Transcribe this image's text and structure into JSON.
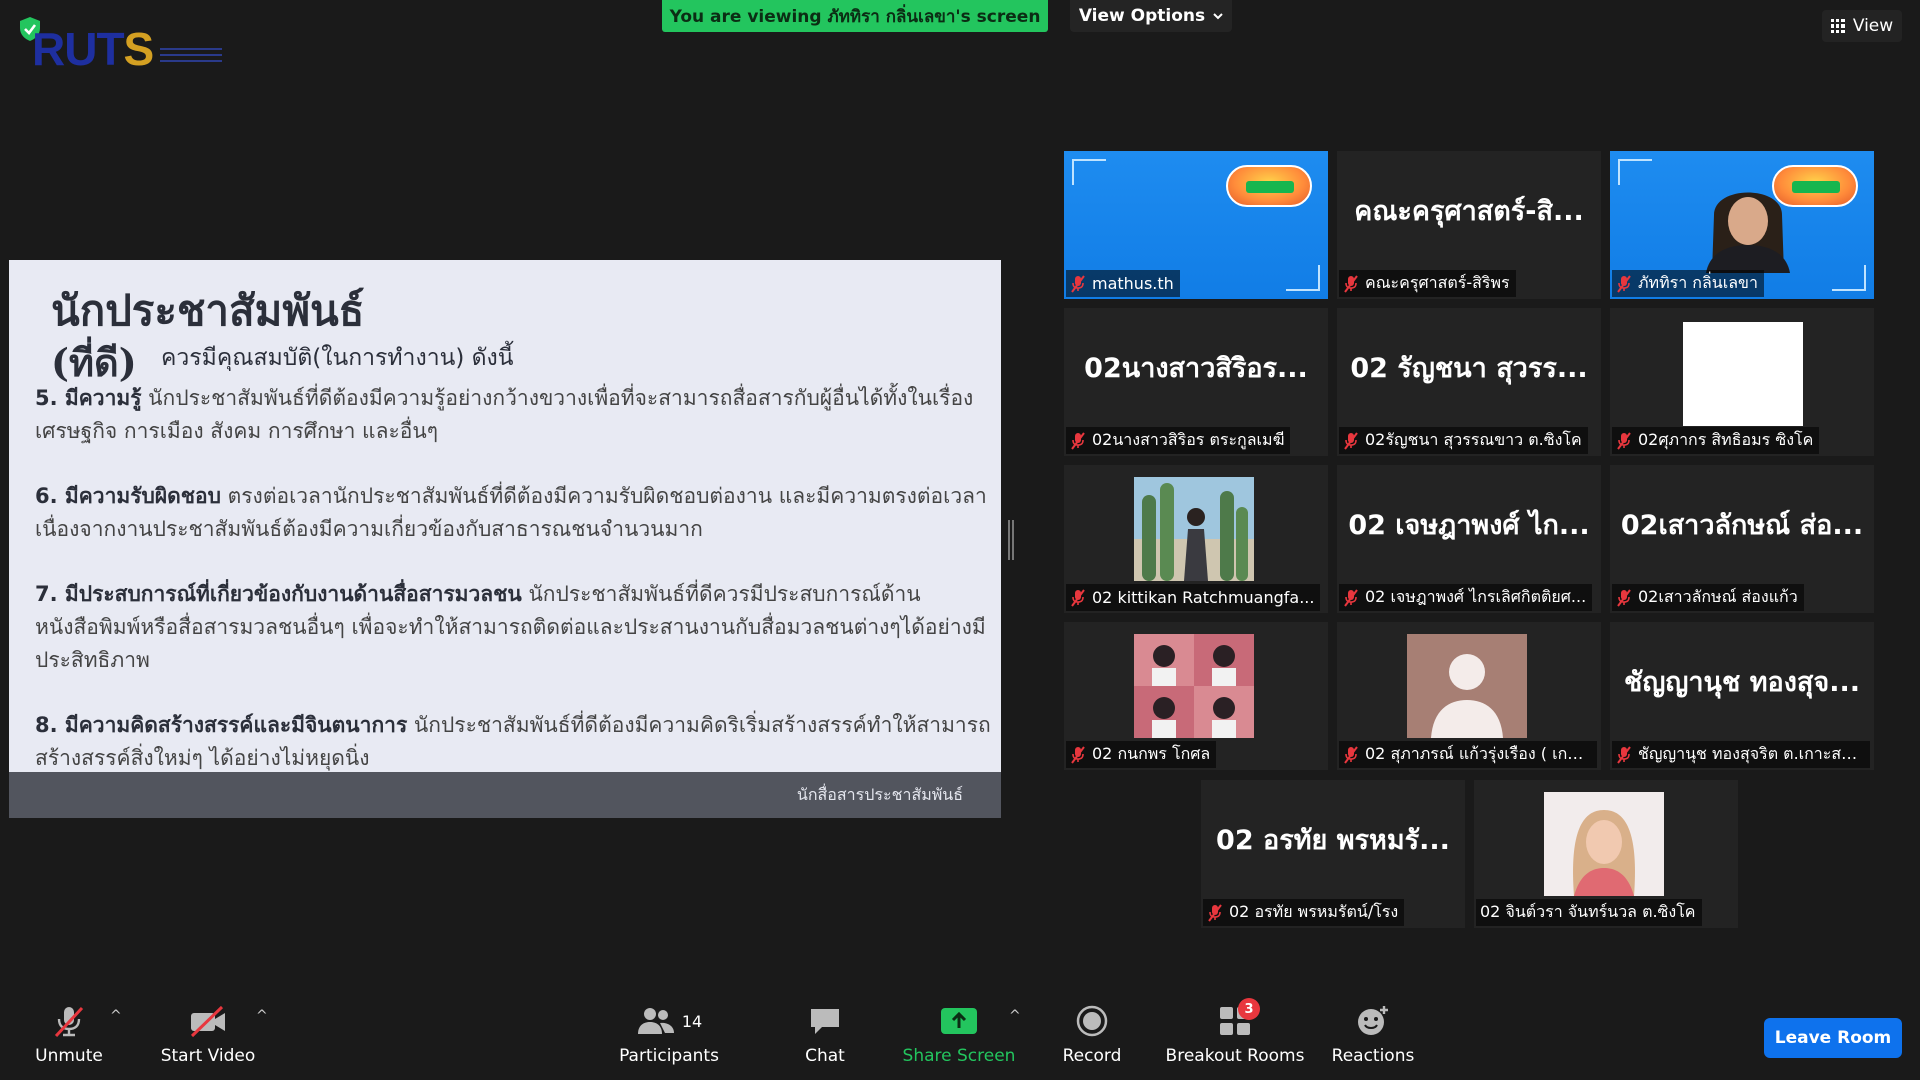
{
  "top": {
    "banner": "You are viewing ภัททิรา กลิ่นเลขา's screen",
    "view_options": "View Options",
    "view": "View",
    "logo_part1": "RUT",
    "logo_part2": "S"
  },
  "slide": {
    "title": "นักประชาสัมพันธ์",
    "subtitle_bold": "(ที่ดี)",
    "subtitle_rest": "ควรมีคุณสมบัติ(ในการทำงาน) ดังนี้",
    "items": [
      {
        "heading": "5. มีความรู้",
        "text": " นักประชาสัมพันธ์ที่ดีต้องมีความรู้อย่างกว้างขวางเพื่อที่จะสามารถสื่อสารกับผู้อื่นได้ทั้งในเรื่องเศรษฐกิจ การเมือง สังคม การศึกษา และอื่นๆ"
      },
      {
        "heading": "6. มีความรับผิดชอบ",
        "text": "  ตรงต่อเวลานักประชาสัมพันธ์ที่ดีต้องมีความรับผิดชอบต่องาน และมีความตรงต่อเวลา เนื่องจากงานประชาสัมพันธ์ต้องมีความเกี่ยวข้องกับสาธารณชนจำนวนมาก"
      },
      {
        "heading": "7. มีประสบการณ์ที่เกี่ยวข้องกับงานด้านสื่อสารมวลชน",
        "text": "  นักประชาสัมพันธ์ที่ดีควรมีประสบการณ์ด้านหนังสือพิมพ์หรือสื่อสารมวลชนอื่นๆ เพื่อจะทำให้สามารถติดต่อและประสานงานกับสื่อมวลชนต่างๆได้อย่างมีประสิทธิภาพ"
      },
      {
        "heading": "8. มีความคิดสร้างสรรค์และมีจินตนาการ",
        "text": " นักประชาสัมพันธ์ที่ดีต้องมีความคิดริเริ่มสร้างสรรค์ทำให้สามารถสร้างสรรค์สิ่งใหม่ๆ ได้อย่างไม่หยุดนิ่ง"
      }
    ],
    "footer": "นักสื่อสารประชาสัมพันธ์"
  },
  "participants": [
    {
      "label": "mathus.th",
      "display": "",
      "kind": "blue"
    },
    {
      "label": "คณะครุศาสตร์-สิริพร",
      "display": "คณะครุศาสตร์-สิ...",
      "kind": "name"
    },
    {
      "label": "ภัททิรา กลิ่นเลขา",
      "display": "",
      "kind": "blue-person"
    },
    {
      "label": "02นางสาวสิริอร ตระกูลเมฆี",
      "display": "02นางสาวสิริอร...",
      "kind": "name"
    },
    {
      "label": "02รัญชนา สุวรรณขาว ต.ซิงโค",
      "display": "02 รัญชนา สุวรร...",
      "kind": "name"
    },
    {
      "label": "02ศุภากร สิทธิอมร ซิงโค",
      "display": "",
      "kind": "white"
    },
    {
      "label": "02 kittikan Ratchmuangfa...",
      "display": "",
      "kind": "photo-cactus"
    },
    {
      "label": "02 เจษฎาพงศ์ ไกรเลิศกิตติยศ...",
      "display": "02 เจษฎาพงศ์ ไก...",
      "kind": "name"
    },
    {
      "label": "02เสาวลักษณ์ ส่องแก้ว",
      "display": "02เสาวลักษณ์ ส่อ...",
      "kind": "name"
    },
    {
      "label": "02 กนกพร โกศล",
      "display": "",
      "kind": "photo-collage"
    },
    {
      "label": "02 สุภาภรณ์ แก้วรุ่งเรือง ( เกา...",
      "display": "",
      "kind": "avatar"
    },
    {
      "label": "ชัญญานุช ทองสุจริต ต.เกาะสะ...",
      "display": "ชัญญานุช ทองสุจ...",
      "kind": "name"
    },
    {
      "label": "02 อรทัย พรหมรัตน์/โรง",
      "display": "02 อรทัย พรหมรั...",
      "kind": "name"
    },
    {
      "label": "02 จินต์วรา จันทร์นวล ต.ซิงโค",
      "display": "",
      "kind": "photo-woman"
    }
  ],
  "toolbar": {
    "unmute": "Unmute",
    "start_video": "Start Video",
    "participants": "Participants",
    "participants_count": "14",
    "chat": "Chat",
    "share_screen": "Share Screen",
    "record": "Record",
    "breakout_rooms": "Breakout Rooms",
    "breakout_badge": "3",
    "reactions": "Reactions",
    "leave": "Leave Room"
  },
  "colors": {
    "banner_green": "#23c55e",
    "share_green": "#23c55e",
    "leave_blue": "#0e72ed",
    "active_speaker": "#f0e85a",
    "mic_off_red": "#e8373e"
  }
}
